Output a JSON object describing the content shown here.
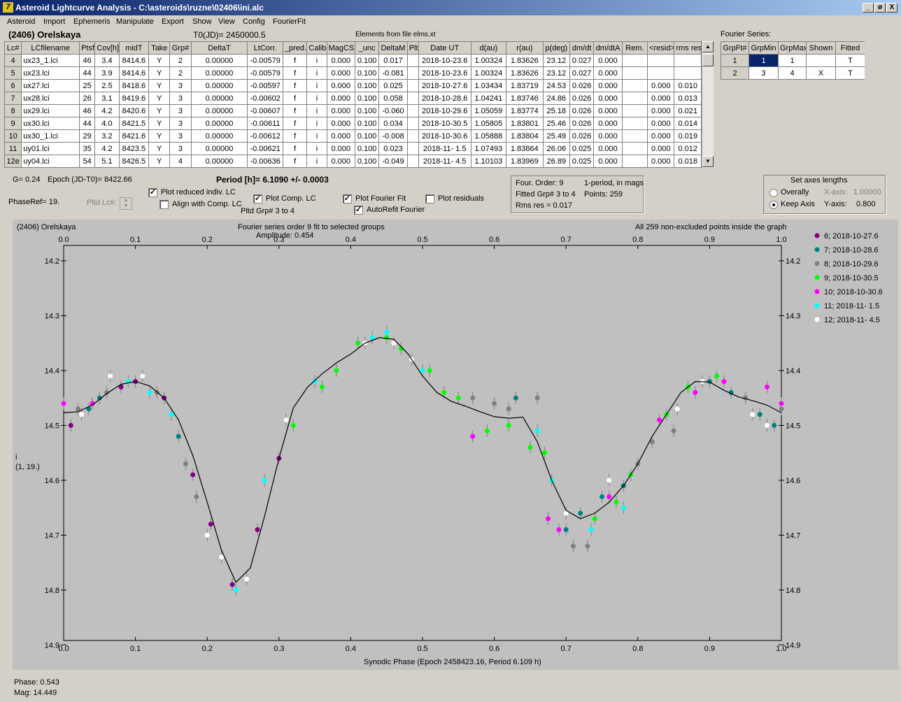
{
  "window": {
    "title": "Asteroid Lightcurve Analysis - C:\\asteroids\\ruzne\\02406\\ini.alc",
    "icon": "app-icon",
    "min": "_",
    "restore": "ø",
    "close": "X"
  },
  "menu": [
    "Asteroid",
    "Import",
    "Ephemeris",
    "Manipulate",
    "Export",
    "Show",
    "View",
    "Config",
    "FourierFit"
  ],
  "header": {
    "object": "(2406) Orelskaya",
    "t0": "T0(JD)= 2450000.5",
    "elements": "Elements from file elms.xt",
    "fourier_label": "Fourier Series:"
  },
  "lc_table": {
    "columns": [
      "Lc#",
      "LCfilename",
      "Ptsf",
      "Cov[h]",
      "midT",
      "Take",
      "Grp#",
      "DeltaT",
      "LtCorr.",
      "_pred.",
      "Calib",
      "MagCS",
      "_unc",
      "DeltaM",
      "Plt",
      "Date UT",
      "d(au)",
      "r(au)",
      "p(deg)",
      "dm/dt",
      "dm/dtA",
      "Rem.",
      "<resid>",
      "rms res"
    ],
    "rows": [
      [
        "4",
        "ux23_1.lci",
        "46",
        "3.4",
        "8414.6",
        "Y",
        "2",
        "0.00000",
        "-0.00579",
        "f",
        "i",
        "0.000",
        "0.100",
        "0.017",
        "",
        "2018-10-23.6",
        "1.00324",
        "1.83626",
        "23.12",
        "0.027",
        "0.000",
        "",
        "",
        ""
      ],
      [
        "5",
        "ux23.lci",
        "44",
        "3.9",
        "8414.6",
        "Y",
        "2",
        "0.00000",
        "-0.00579",
        "f",
        "i",
        "0.000",
        "0.100",
        "-0.081",
        "",
        "2018-10-23.6",
        "1.00324",
        "1.83626",
        "23.12",
        "0.027",
        "0.000",
        "",
        "",
        ""
      ],
      [
        "6",
        "ux27.lci",
        "25",
        "2.5",
        "8418.6",
        "Y",
        "3",
        "0.00000",
        "-0.00597",
        "f",
        "i",
        "0.000",
        "0.100",
        "0.025",
        "",
        "2018-10-27.6",
        "1.03434",
        "1.83719",
        "24.53",
        "0.026",
        "0.000",
        "",
        "0.000",
        "0.010"
      ],
      [
        "7",
        "ux28.lci",
        "26",
        "3.1",
        "8419.6",
        "Y",
        "3",
        "0.00000",
        "-0.00602",
        "f",
        "i",
        "0.000",
        "0.100",
        "0.058",
        "",
        "2018-10-28.6",
        "1.04241",
        "1.83746",
        "24.86",
        "0.026",
        "0.000",
        "",
        "0.000",
        "0.013"
      ],
      [
        "8",
        "ux29.lci",
        "46",
        "4.2",
        "8420.6",
        "Y",
        "3",
        "0.00000",
        "-0.00607",
        "f",
        "i",
        "0.000",
        "0.100",
        "-0.060",
        "",
        "2018-10-29.6",
        "1.05059",
        "1.83774",
        "25.18",
        "0.026",
        "0.000",
        "",
        "0.000",
        "0.021"
      ],
      [
        "9",
        "ux30.lci",
        "44",
        "4.0",
        "8421.5",
        "Y",
        "3",
        "0.00000",
        "-0.00611",
        "f",
        "i",
        "0.000",
        "0.100",
        "0.034",
        "",
        "2018-10-30.5",
        "1.05805",
        "1.83801",
        "25.46",
        "0.026",
        "0.000",
        "",
        "0.000",
        "0.014"
      ],
      [
        "10",
        "ux30_1.lci",
        "29",
        "3.2",
        "8421.6",
        "Y",
        "3",
        "0.00000",
        "-0.00612",
        "f",
        "i",
        "0.000",
        "0.100",
        "-0.008",
        "",
        "2018-10-30.6",
        "1.05888",
        "1.83804",
        "25.49",
        "0.026",
        "0.000",
        "",
        "0.000",
        "0.019"
      ],
      [
        "11",
        "uy01.lci",
        "35",
        "4.2",
        "8423.5",
        "Y",
        "3",
        "0.00000",
        "-0.00621",
        "f",
        "i",
        "0.000",
        "0.100",
        "0.023",
        "",
        "2018-11- 1.5",
        "1.07493",
        "1.83864",
        "26.06",
        "0.025",
        "0.000",
        "",
        "0.000",
        "0.012"
      ],
      [
        "12e",
        "uy04.lci",
        "54",
        "5.1",
        "8426.5",
        "Y",
        "4",
        "0.00000",
        "-0.00636",
        "f",
        "i",
        "0.000",
        "0.100",
        "-0.049",
        "",
        "2018-11- 4.5",
        "1.10103",
        "1.83969",
        "26.89",
        "0.025",
        "0.000",
        "",
        "0.000",
        "0.018"
      ]
    ]
  },
  "fourier_table": {
    "columns": [
      "GrpFt#",
      "GrpMin",
      "GrpMax",
      "Shown",
      "Fitted"
    ],
    "rows": [
      [
        "1",
        "1",
        "1",
        "",
        "T"
      ],
      [
        "2",
        "3",
        "4",
        "X",
        "T"
      ]
    ]
  },
  "controls": {
    "g": "G= 0.24",
    "epoch": "Epoch (JD-T0)= 8422.66",
    "period": "Period [h]= 6.1090 +/- 0.0003",
    "phaseref": "PhaseRef= 19.",
    "pltd_lc": "Pltd Lc#:",
    "plot_reduced": "Plot reduced indiv. LC",
    "align_comp": "Align with Comp. LC",
    "plot_comp": "Plot Comp. LC",
    "pltd_grp": "Pltd Grp#  3  to  4",
    "plot_fourier": "Plot Fourier Fit",
    "autorefit": "AutoRefit Fourier",
    "plot_resid": "Plot residuals",
    "info": {
      "order": "Four. Order:  9",
      "mode": "1-period, in mags",
      "fitted": "Fitted Grp# 3 to 4",
      "points": "Points: 259",
      "rms": "Rms res     = 0.017"
    },
    "axes": {
      "title": "Set axes lengths",
      "overall": "Overally",
      "keep": "Keep Axis",
      "xaxis": "X-axis:",
      "xval": "1.00000",
      "yaxis": "Y-axis:",
      "yval": "0.800"
    },
    "check": "✓"
  },
  "plot_text": {
    "object": "(2406) Orelskaya",
    "subtitle": "Fourier series order 9 fit to selected groups",
    "amplitude": "Amplitude: 0.454",
    "all_points": "All 259 non-excluded points inside the graph",
    "ylabel1": "i",
    "ylabel2": "(1, 19.)",
    "xlabel": "Synodic Phase (Epoch 2458423.16, Period 6.109 h)"
  },
  "status": {
    "phase": "Phase:  0.543",
    "mag": "Mag:   14.449"
  },
  "chart_data": {
    "type": "scatter",
    "xlim": [
      0,
      1
    ],
    "ylim": [
      14.2,
      14.92
    ],
    "xticks": [
      "0.0",
      "0.1",
      "0.2",
      "0.3",
      "0.4",
      "0.5",
      "0.6",
      "0.7",
      "0.8",
      "0.9",
      "1.0"
    ],
    "yticks": [
      "14.2",
      "14.3",
      "14.4",
      "14.5",
      "14.6",
      "14.7",
      "14.8",
      "14.9"
    ],
    "fit_curve": {
      "x": [
        0,
        0.02,
        0.04,
        0.06,
        0.08,
        0.1,
        0.12,
        0.14,
        0.16,
        0.18,
        0.2,
        0.22,
        0.24,
        0.26,
        0.28,
        0.3,
        0.32,
        0.34,
        0.36,
        0.38,
        0.4,
        0.42,
        0.44,
        0.46,
        0.48,
        0.5,
        0.52,
        0.54,
        0.56,
        0.58,
        0.6,
        0.62,
        0.64,
        0.66,
        0.68,
        0.7,
        0.72,
        0.74,
        0.76,
        0.78,
        0.8,
        0.82,
        0.84,
        0.86,
        0.88,
        0.9,
        0.92,
        0.94,
        0.96,
        0.98,
        1.0
      ],
      "y": [
        14.477,
        14.475,
        14.463,
        14.442,
        14.425,
        14.42,
        14.428,
        14.45,
        14.49,
        14.555,
        14.64,
        14.728,
        14.786,
        14.76,
        14.665,
        14.56,
        14.468,
        14.43,
        14.406,
        14.386,
        14.37,
        14.35,
        14.34,
        14.343,
        14.37,
        14.41,
        14.44,
        14.456,
        14.465,
        14.475,
        14.484,
        14.487,
        14.485,
        14.53,
        14.6,
        14.655,
        14.67,
        14.66,
        14.64,
        14.61,
        14.57,
        14.52,
        14.48,
        14.44,
        14.42,
        14.421,
        14.436,
        14.448,
        14.455,
        14.463,
        14.477
      ]
    },
    "series": [
      {
        "name": "6; 2018-10-27.6",
        "color": "#800080",
        "points": [
          [
            0.01,
            14.5
          ],
          [
            0.08,
            14.43
          ],
          [
            0.1,
            14.42
          ],
          [
            0.14,
            14.45
          ],
          [
            0.18,
            14.59
          ],
          [
            0.205,
            14.68
          ],
          [
            0.235,
            14.79
          ],
          [
            0.27,
            14.69
          ],
          [
            0.3,
            14.56
          ]
        ]
      },
      {
        "name": "7; 2018-10-28.6",
        "color": "#008080",
        "points": [
          [
            0.035,
            14.47
          ],
          [
            0.05,
            14.45
          ],
          [
            0.16,
            14.52
          ],
          [
            0.63,
            14.45
          ],
          [
            0.7,
            14.69
          ],
          [
            0.72,
            14.66
          ],
          [
            0.75,
            14.63
          ],
          [
            0.78,
            14.61
          ],
          [
            0.9,
            14.42
          ],
          [
            0.93,
            14.44
          ],
          [
            0.97,
            14.48
          ],
          [
            0.99,
            14.5
          ]
        ]
      },
      {
        "name": "8; 2018-10-29.6",
        "color": "#808080",
        "points": [
          [
            0.02,
            14.47
          ],
          [
            0.06,
            14.44
          ],
          [
            0.13,
            14.44
          ],
          [
            0.17,
            14.57
          ],
          [
            0.185,
            14.63
          ],
          [
            0.57,
            14.45
          ],
          [
            0.6,
            14.46
          ],
          [
            0.62,
            14.47
          ],
          [
            0.66,
            14.45
          ],
          [
            0.71,
            14.72
          ],
          [
            0.73,
            14.72
          ],
          [
            0.8,
            14.57
          ],
          [
            0.82,
            14.53
          ],
          [
            0.85,
            14.51
          ],
          [
            0.95,
            14.45
          ],
          [
            1.0,
            14.47
          ]
        ]
      },
      {
        "name": "9; 2018-10-30.5",
        "color": "#00ff00",
        "points": [
          [
            0.32,
            14.5
          ],
          [
            0.36,
            14.43
          ],
          [
            0.38,
            14.4
          ],
          [
            0.41,
            14.35
          ],
          [
            0.45,
            14.34
          ],
          [
            0.47,
            14.36
          ],
          [
            0.51,
            14.4
          ],
          [
            0.53,
            14.44
          ],
          [
            0.55,
            14.45
          ],
          [
            0.59,
            14.51
          ],
          [
            0.62,
            14.5
          ],
          [
            0.65,
            14.54
          ],
          [
            0.67,
            14.55
          ],
          [
            0.74,
            14.67
          ],
          [
            0.77,
            14.64
          ],
          [
            0.79,
            14.59
          ],
          [
            0.84,
            14.48
          ],
          [
            0.87,
            14.43
          ],
          [
            0.91,
            14.41
          ]
        ]
      },
      {
        "name": "10; 2018-10-30.6",
        "color": "#ff00ff",
        "points": [
          [
            0.0,
            14.46
          ],
          [
            0.04,
            14.46
          ],
          [
            0.57,
            14.52
          ],
          [
            0.675,
            14.67
          ],
          [
            0.69,
            14.69
          ],
          [
            0.76,
            14.63
          ],
          [
            0.83,
            14.49
          ],
          [
            0.88,
            14.44
          ],
          [
            0.92,
            14.42
          ],
          [
            0.98,
            14.43
          ],
          [
            1.0,
            14.46
          ]
        ]
      },
      {
        "name": "11; 2018-11- 1.5",
        "color": "#00ffff",
        "points": [
          [
            0.09,
            14.42
          ],
          [
            0.12,
            14.44
          ],
          [
            0.15,
            14.48
          ],
          [
            0.24,
            14.8
          ],
          [
            0.28,
            14.6
          ],
          [
            0.35,
            14.42
          ],
          [
            0.43,
            14.34
          ],
          [
            0.45,
            14.33
          ],
          [
            0.5,
            14.4
          ],
          [
            0.66,
            14.51
          ],
          [
            0.68,
            14.6
          ],
          [
            0.735,
            14.69
          ],
          [
            0.78,
            14.65
          ]
        ]
      },
      {
        "name": "12; 2018-11- 4.5",
        "color": "#ffffff",
        "points": [
          [
            0.025,
            14.48
          ],
          [
            0.065,
            14.41
          ],
          [
            0.11,
            14.41
          ],
          [
            0.2,
            14.7
          ],
          [
            0.22,
            14.74
          ],
          [
            0.255,
            14.78
          ],
          [
            0.31,
            14.49
          ],
          [
            0.42,
            14.35
          ],
          [
            0.46,
            14.35
          ],
          [
            0.485,
            14.38
          ],
          [
            0.7,
            14.66
          ],
          [
            0.76,
            14.6
          ],
          [
            0.855,
            14.47
          ],
          [
            0.89,
            14.42
          ],
          [
            0.96,
            14.48
          ],
          [
            0.98,
            14.5
          ]
        ]
      }
    ]
  }
}
